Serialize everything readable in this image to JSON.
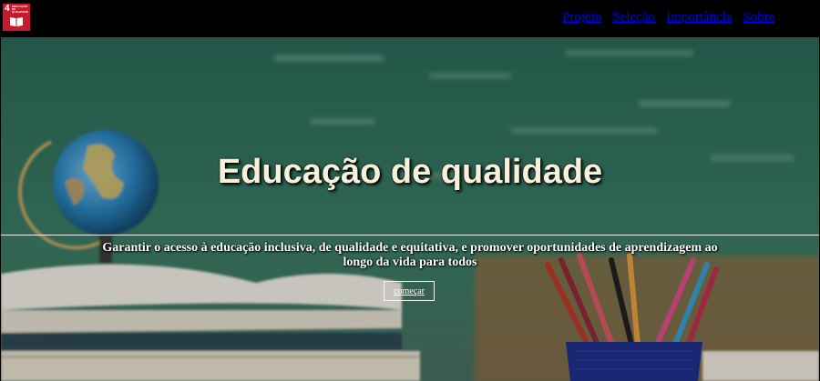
{
  "logo": {
    "number": "4",
    "text": "EDUCAÇÃO DE QUALIDADE",
    "color": "#c5192d",
    "icon": "book-icon"
  },
  "nav": {
    "items": [
      {
        "label": "Projeto"
      },
      {
        "label": "Seleção"
      },
      {
        "label": "Importância"
      },
      {
        "label": "Sobre"
      }
    ]
  },
  "hero": {
    "title": "Educação de qualidade",
    "subtitle": "Garantir o acesso à educação inclusiva, de qualidade e equitativa, e promover oportunidades de aprendizagem ao longo da vida para todos",
    "cta_label": "começar",
    "background": "classroom photo: chalkboard, globe, books, pencils"
  },
  "colors": {
    "topbar": "#000000",
    "link": "#0000ee",
    "title": "#f7f1dc",
    "chalkboard": "#2f6e5c"
  }
}
